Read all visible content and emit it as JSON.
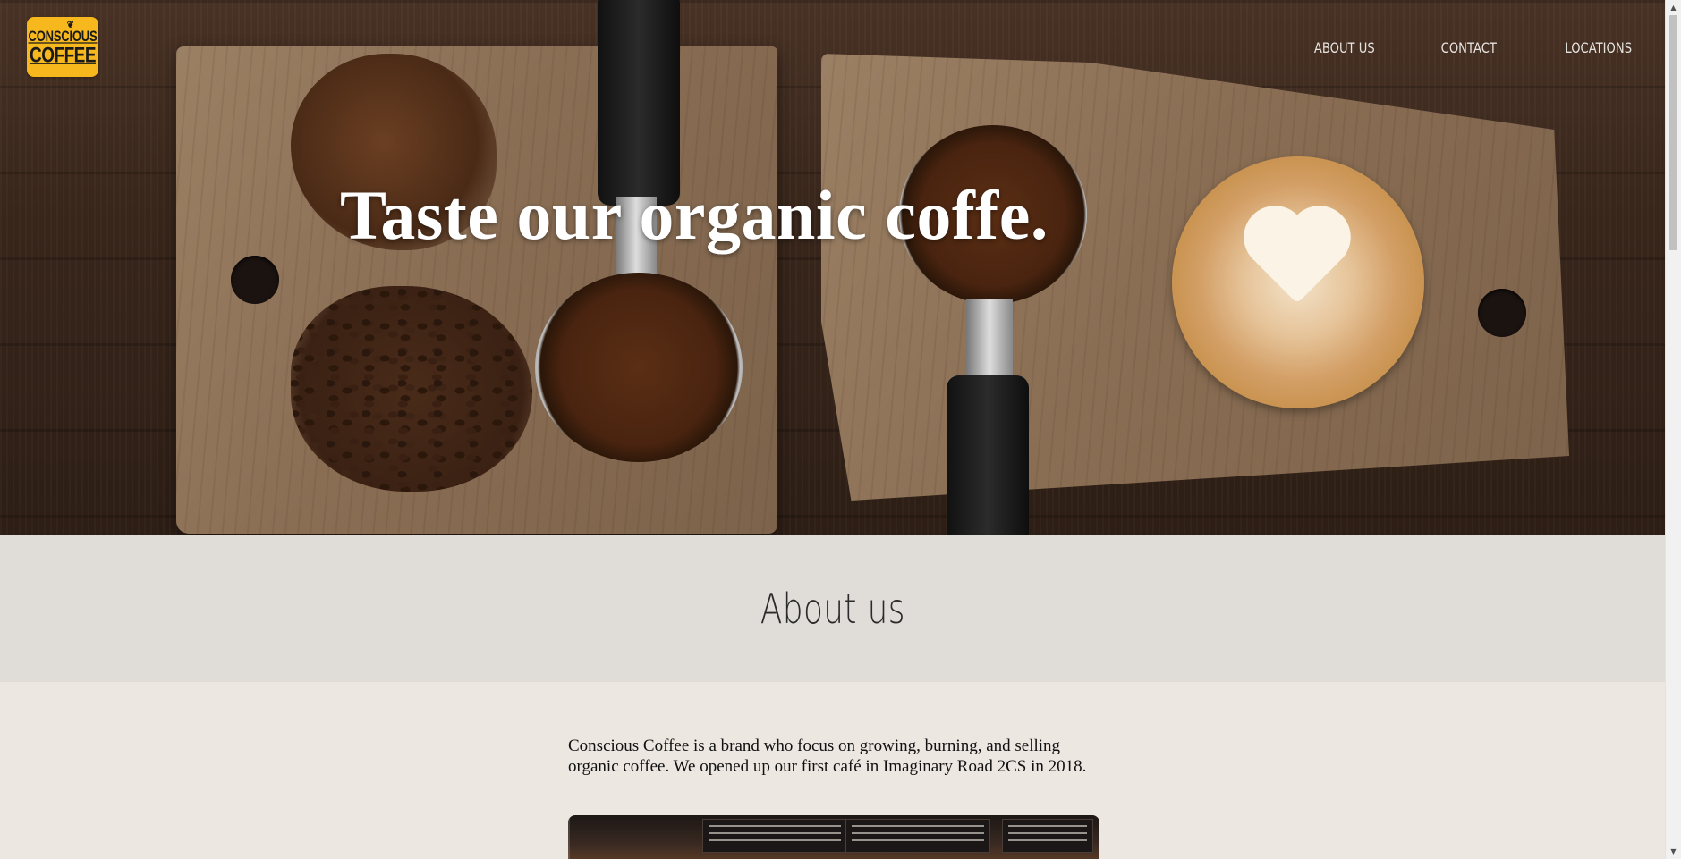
{
  "brand": {
    "logo_top": "CONSCIOUS",
    "logo_bottom": "COFFEE"
  },
  "nav": {
    "items": [
      {
        "label": "ABOUT US"
      },
      {
        "label": "CONTACT"
      },
      {
        "label": "LOCATIONS"
      }
    ]
  },
  "hero": {
    "title": "Taste our organic coffe."
  },
  "about": {
    "title": "About us",
    "text": "Conscious Coffee is a brand who focus on growing, burning, and selling organic coffee. We opened up our first café in Imaginary Road 2CS in 2018."
  },
  "colors": {
    "logo_bg": "#f6b81c",
    "about_band": "#e0dcd8",
    "page_bg": "#ede7e2",
    "nav_text": "#e6e2de"
  },
  "icons": {
    "scroll_up": "triangle-up",
    "scroll_down": "triangle-down"
  }
}
